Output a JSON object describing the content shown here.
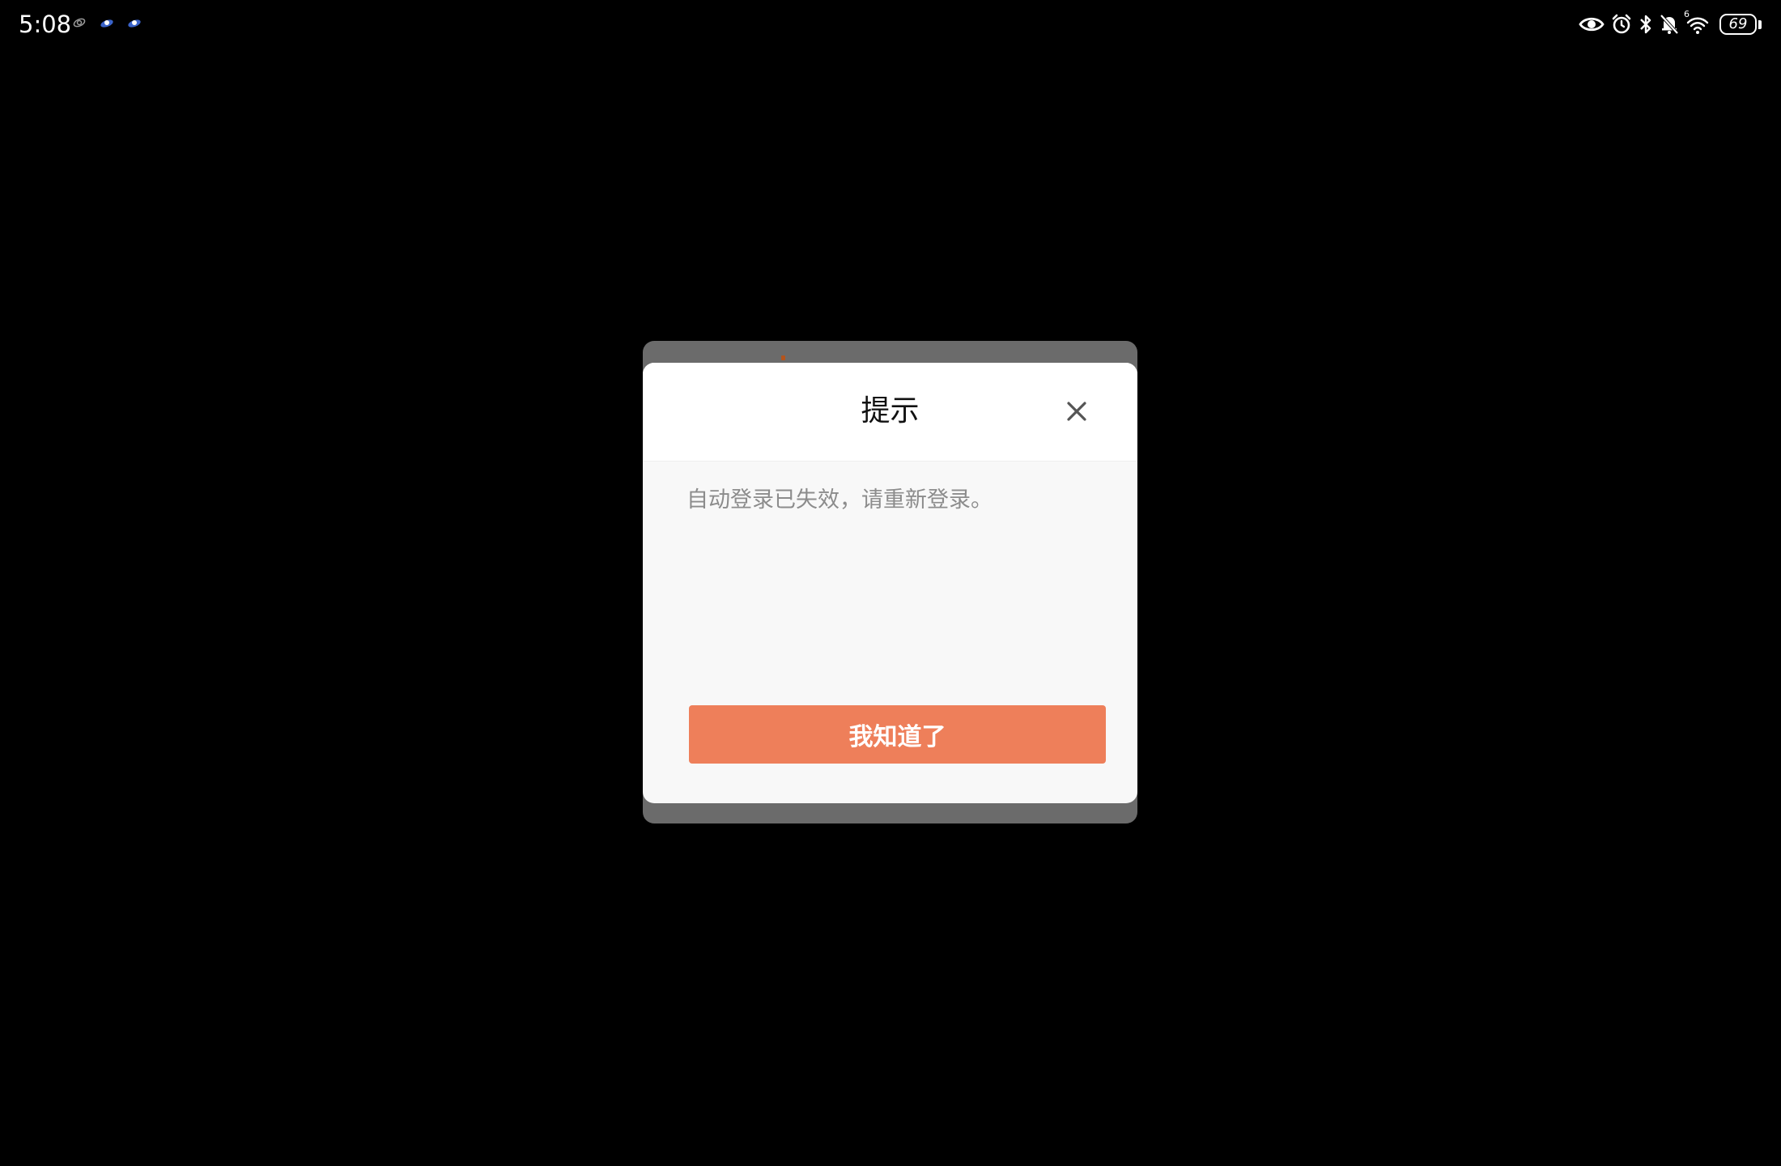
{
  "status_bar": {
    "time": "5:08",
    "left_icons": [
      "app-notification-icon",
      "app-notification-icon",
      "app-notification-icon"
    ],
    "right_icons": [
      "eye-icon",
      "alarm-icon",
      "bluetooth-icon",
      "mute-icon",
      "wifi-icon"
    ],
    "wifi_badge": "6",
    "battery_level": "69"
  },
  "dialog": {
    "title": "提示",
    "message": "自动登录已失效，请重新登录。",
    "confirm_label": "我知道了",
    "accent_color": "#ee7f5a"
  }
}
